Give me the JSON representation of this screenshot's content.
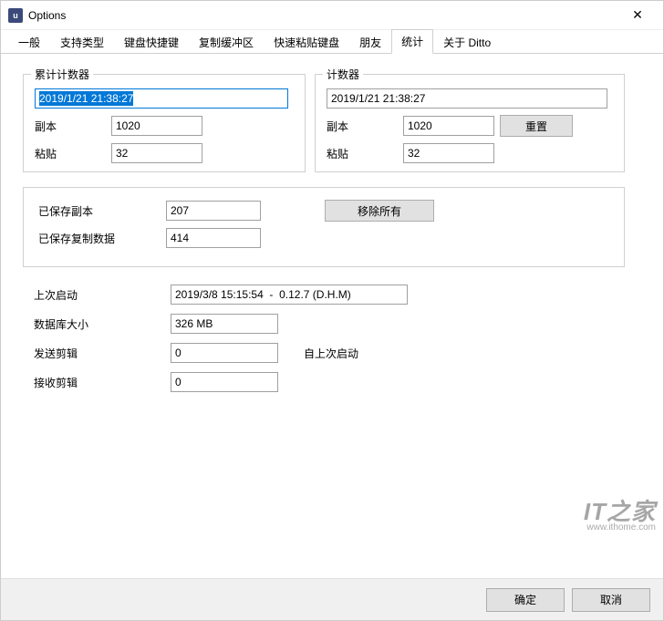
{
  "window": {
    "title": "Options"
  },
  "tabs": [
    "一般",
    "支持类型",
    "键盘快捷键",
    "复制缓冲区",
    "快速粘贴键盘",
    "朋友",
    "统计",
    "关于 Ditto"
  ],
  "active_tab_index": 6,
  "group1": {
    "title": "累计计数器",
    "date": "2019/1/21 21:38:27",
    "copy_label": "副本",
    "copy_value": "1020",
    "paste_label": "粘贴",
    "paste_value": "32"
  },
  "group2": {
    "title": "计数器",
    "date": "2019/1/21 21:38:27",
    "copy_label": "副本",
    "copy_value": "1020",
    "paste_label": "粘贴",
    "paste_value": "32",
    "reset_label": "重置"
  },
  "saved": {
    "copies_label": "已保存副本",
    "copies_value": "207",
    "data_label": "已保存复制数据",
    "data_value": "414",
    "remove_all_label": "移除所有"
  },
  "stats": {
    "last_start_label": "上次启动",
    "last_start_value": "2019/3/8 15:15:54  -  0.12.7 (D.H.M)",
    "db_size_label": "数据库大小",
    "db_size_value": "326 MB",
    "send_label": "发送剪辑",
    "send_value": "0",
    "recv_label": "接收剪辑",
    "recv_value": "0",
    "since_label": "自上次启动"
  },
  "footer": {
    "ok": "确定",
    "cancel": "取消"
  },
  "watermark": {
    "brand": "IT之家",
    "url": "www.ithome.com"
  }
}
